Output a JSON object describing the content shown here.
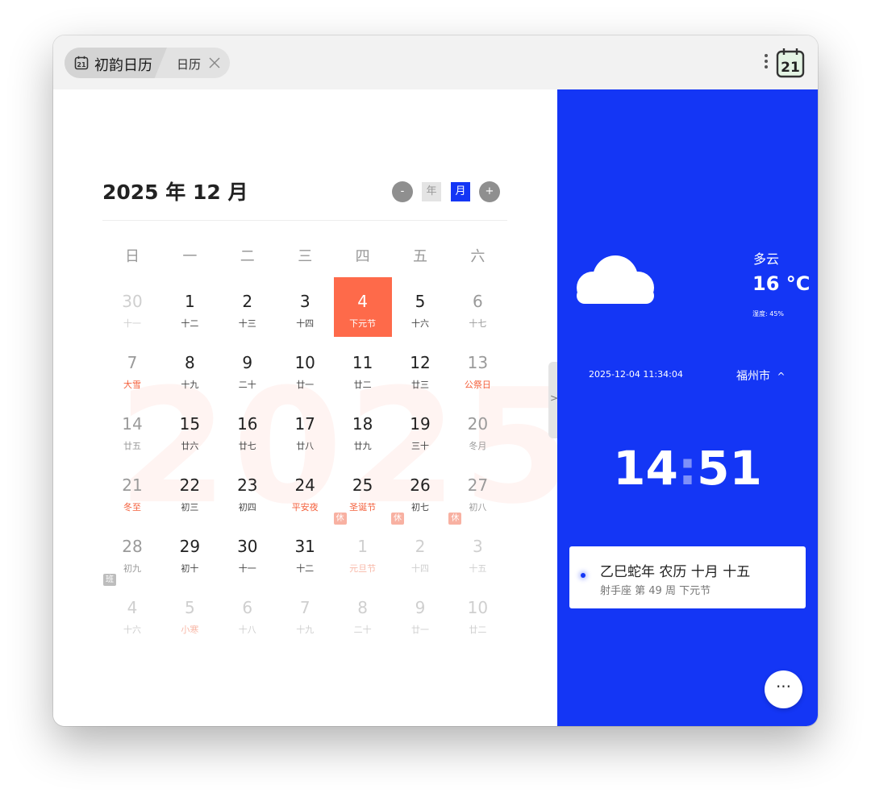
{
  "tab": {
    "app_title": "初韵日历",
    "sub_title": "日历",
    "icon_day": "21"
  },
  "header": {
    "month_title": "2025 年 12 月",
    "prev": "-",
    "year_btn": "年",
    "month_btn": "月",
    "next": "+"
  },
  "watermark": "2025",
  "weekdays": [
    "日",
    "一",
    "二",
    "三",
    "四",
    "五",
    "六"
  ],
  "colors": {
    "accent": "#1436f5",
    "selected": "#fe6a4a",
    "festival": "#f4603c"
  },
  "days": [
    {
      "n": "30",
      "l": "十一",
      "other": true
    },
    {
      "n": "1",
      "l": "十二"
    },
    {
      "n": "2",
      "l": "十三"
    },
    {
      "n": "3",
      "l": "十四"
    },
    {
      "n": "4",
      "l": "下元节",
      "sel": true,
      "red": true
    },
    {
      "n": "5",
      "l": "十六"
    },
    {
      "n": "6",
      "l": "十七"
    },
    {
      "n": "7",
      "l": "大雪",
      "red": true
    },
    {
      "n": "8",
      "l": "十九"
    },
    {
      "n": "9",
      "l": "二十"
    },
    {
      "n": "10",
      "l": "廿一"
    },
    {
      "n": "11",
      "l": "廿二"
    },
    {
      "n": "12",
      "l": "廿三"
    },
    {
      "n": "13",
      "l": "公祭日",
      "red": true
    },
    {
      "n": "14",
      "l": "廿五"
    },
    {
      "n": "15",
      "l": "廿六"
    },
    {
      "n": "16",
      "l": "廿七"
    },
    {
      "n": "17",
      "l": "廿八"
    },
    {
      "n": "18",
      "l": "廿九"
    },
    {
      "n": "19",
      "l": "三十"
    },
    {
      "n": "20",
      "l": "冬月"
    },
    {
      "n": "21",
      "l": "冬至",
      "red": true
    },
    {
      "n": "22",
      "l": "初三"
    },
    {
      "n": "23",
      "l": "初四"
    },
    {
      "n": "24",
      "l": "平安夜",
      "red": true
    },
    {
      "n": "25",
      "l": "圣诞节",
      "red": true
    },
    {
      "n": "26",
      "l": "初七"
    },
    {
      "n": "27",
      "l": "初八"
    },
    {
      "n": "28",
      "l": "初九"
    },
    {
      "n": "29",
      "l": "初十"
    },
    {
      "n": "30",
      "l": "十一"
    },
    {
      "n": "31",
      "l": "十二"
    },
    {
      "n": "1",
      "l": "元旦节",
      "other": true,
      "red": true,
      "badge": "休"
    },
    {
      "n": "2",
      "l": "十四",
      "other": true,
      "badge": "休"
    },
    {
      "n": "3",
      "l": "十五",
      "other": true,
      "badge": "休"
    },
    {
      "n": "4",
      "l": "十六",
      "other": true,
      "badge": "班"
    },
    {
      "n": "5",
      "l": "小寒",
      "other": true,
      "red": true
    },
    {
      "n": "6",
      "l": "十八",
      "other": true
    },
    {
      "n": "7",
      "l": "十九",
      "other": true
    },
    {
      "n": "8",
      "l": "二十",
      "other": true
    },
    {
      "n": "9",
      "l": "廿一",
      "other": true
    },
    {
      "n": "10",
      "l": "廿二",
      "other": true
    }
  ],
  "weather": {
    "desc": "多云",
    "temp": "16 °C",
    "humidity": "湿度: 45%",
    "datetime": "2025-12-04 11:34:04",
    "city": "福州市",
    "city_caret": "^",
    "icon": "cloud-icon"
  },
  "clock": {
    "hours": "14",
    "sep": ":",
    "minutes": "51"
  },
  "lunar_card": {
    "main": "乙巳蛇年  农历 十月 十五",
    "sub": "射手座  第 49 周  下元节"
  },
  "fab": "···",
  "handle": ">"
}
